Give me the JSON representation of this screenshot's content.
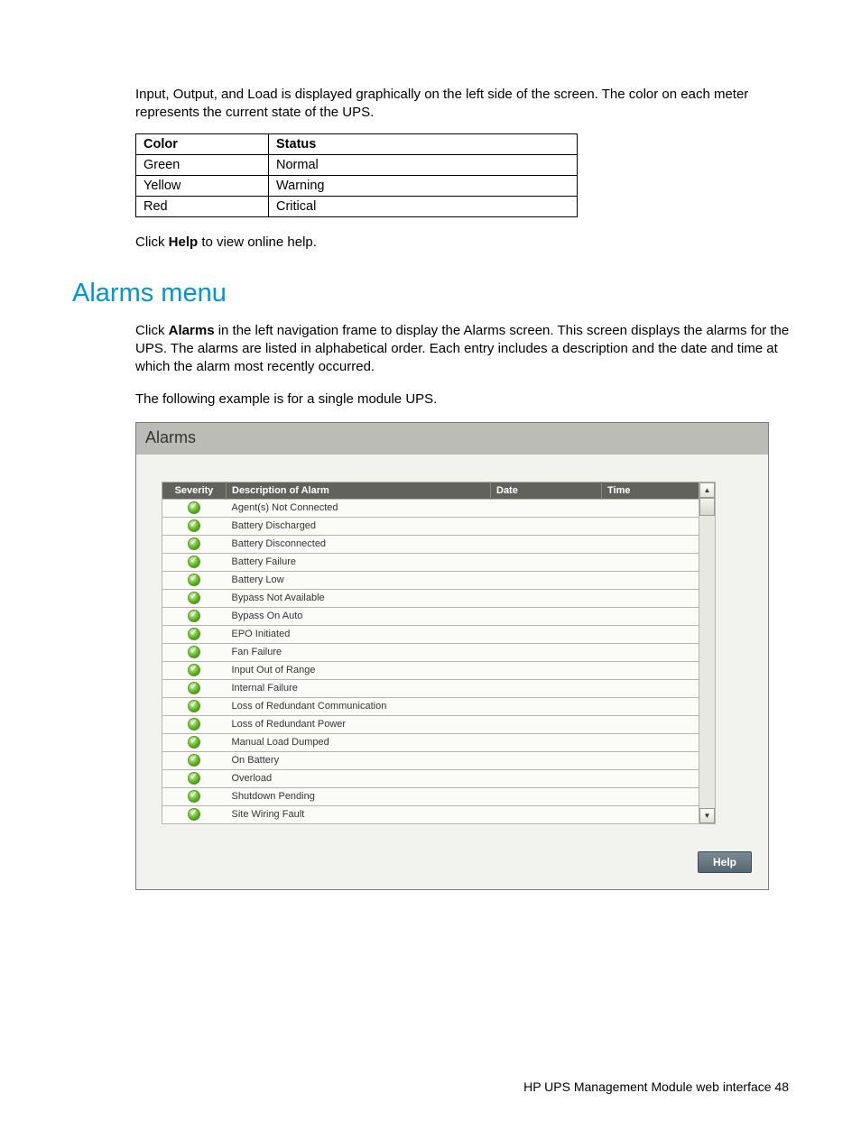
{
  "intro_paragraph": "Input, Output, and Load is displayed graphically on the left side of the screen. The color on each meter represents the current state of the UPS.",
  "color_table": {
    "headers": {
      "c1": "Color",
      "c2": "Status"
    },
    "rows": [
      {
        "color": "Green",
        "status": "Normal"
      },
      {
        "color": "Yellow",
        "status": "Warning"
      },
      {
        "color": "Red",
        "status": "Critical"
      }
    ]
  },
  "help_line_pre": "Click ",
  "help_line_bold": "Help",
  "help_line_post": " to view online help.",
  "section_heading": "Alarms menu",
  "alarms_p1_pre": "Click ",
  "alarms_p1_bold": "Alarms",
  "alarms_p1_post": " in the left navigation frame to display the Alarms screen. This screen displays the alarms for the UPS. The alarms are listed in alphabetical order. Each entry includes a description and the date and time at which the alarm most recently occurred.",
  "alarms_p2": "The following example is for a single module UPS.",
  "screenshot": {
    "title": "Alarms",
    "headers": {
      "severity": "Severity",
      "desc": "Description of Alarm",
      "date": "Date",
      "time": "Time"
    },
    "rows": [
      "Agent(s) Not Connected",
      "Battery Discharged",
      "Battery Disconnected",
      "Battery Failure",
      "Battery Low",
      "Bypass Not Available",
      "Bypass On Auto",
      "EPO Initiated",
      "Fan Failure",
      "Input Out of Range",
      "Internal Failure",
      "Loss of Redundant Communication",
      "Loss of Redundant Power",
      "Manual Load Dumped",
      "On Battery",
      "Overload",
      "Shutdown Pending",
      "Site Wiring Fault"
    ],
    "help_button": "Help"
  },
  "footer": "HP UPS Management Module web interface   48"
}
